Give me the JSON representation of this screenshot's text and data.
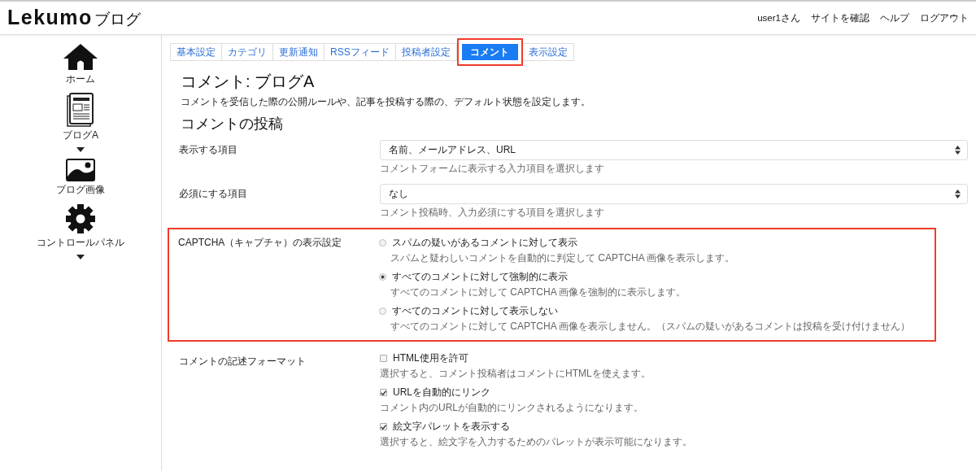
{
  "header": {
    "logo": "Lekumo",
    "logo_suffix": "ブログ",
    "links": [
      "user1さん",
      "サイトを確認",
      "ヘルプ",
      "ログアウト"
    ]
  },
  "sidebar": {
    "items": [
      {
        "label": "ホーム",
        "dropdown": false
      },
      {
        "label": "ブログA",
        "dropdown": true
      },
      {
        "label": "ブログ画像",
        "dropdown": false
      },
      {
        "label": "コントロールパネル",
        "dropdown": true
      }
    ]
  },
  "tabs": [
    {
      "label": "基本設定",
      "selected": false,
      "highlighted": false
    },
    {
      "label": "カテゴリ",
      "selected": false,
      "highlighted": false
    },
    {
      "label": "更新通知",
      "selected": false,
      "highlighted": false
    },
    {
      "label": "RSSフィード",
      "selected": false,
      "highlighted": false
    },
    {
      "label": "投稿者設定",
      "selected": false,
      "highlighted": false
    },
    {
      "label": "コメント",
      "selected": true,
      "highlighted": true
    },
    {
      "label": "表示設定",
      "selected": false,
      "highlighted": false
    }
  ],
  "page": {
    "title": "コメント: ブログA",
    "description": "コメントを受信した際の公開ルールや、記事を投稿する際の、デフォルト状態を設定します。",
    "section_title": "コメントの投稿"
  },
  "settings": [
    {
      "kind": "select",
      "label": "表示する項目",
      "highlighted": false,
      "value": "名前、メールアドレス、URL",
      "help": "コメントフォームに表示する入力項目を選択します"
    },
    {
      "kind": "select",
      "label": "必須にする項目",
      "highlighted": false,
      "value": "なし",
      "help": "コメント投稿時、入力必須にする項目を選択します"
    },
    {
      "kind": "radio",
      "label": "CAPTCHA（キャプチャ）の表示設定",
      "highlighted": true,
      "options": [
        {
          "label": "スパムの疑いがあるコメントに対して表示",
          "help": "スパムと疑わしいコメントを自動的に判定して CAPTCHA 画像を表示します。",
          "selected": false
        },
        {
          "label": "すべてのコメントに対して強制的に表示",
          "help": "すべてのコメントに対して CAPTCHA 画像を強制的に表示します。",
          "selected": true
        },
        {
          "label": "すべてのコメントに対して表示しない",
          "help": "すべてのコメントに対して CAPTCHA 画像を表示しません。（スパムの疑いがあるコメントは投稿を受け付けません）",
          "selected": false
        }
      ]
    },
    {
      "kind": "checkbox",
      "label": "コメントの記述フォーマット",
      "highlighted": false,
      "options": [
        {
          "label": "HTML使用を許可",
          "help": "選択すると、コメント投稿者はコメントにHTMLを使えます。",
          "checked": false
        },
        {
          "label": "URLを自動的にリンク",
          "help": "コメント内のURLが自動的にリンクされるようになります。",
          "checked": true
        },
        {
          "label": "絵文字パレットを表示する",
          "help": "選択すると、絵文字を入力するためのパレットが表示可能になります。",
          "checked": true
        }
      ]
    }
  ]
}
